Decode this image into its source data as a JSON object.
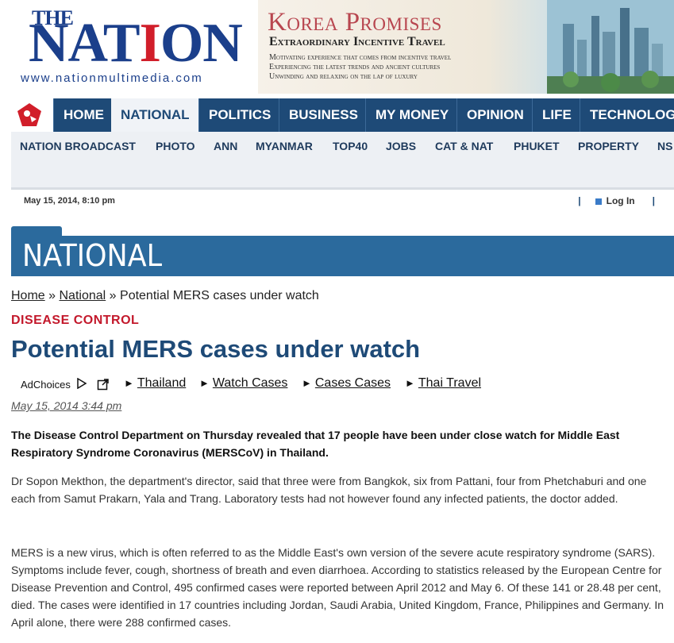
{
  "header": {
    "logo_the": "THE",
    "logo_nation_a": "NAT",
    "logo_nation_i": "I",
    "logo_nation_b": "ON",
    "logo_url": "www.nationmultimedia.com"
  },
  "ad_banner": {
    "headline": "Korea Promises",
    "subheadline": "Extraordinary Incentive Travel",
    "lines": [
      "Motivating experience that comes from incentive travel",
      "Experiencing the latest trends and ancient cultures",
      "Unwinding and relaxing on the lap of luxury"
    ]
  },
  "nav": {
    "main": [
      "HOME",
      "NATIONAL",
      "POLITICS",
      "BUSINESS",
      "MY MONEY",
      "OPINION",
      "LIFE",
      "TECHNOLOG"
    ],
    "active": "NATIONAL",
    "sub": [
      "NATION BROADCAST",
      "PHOTO",
      "ANN",
      "MYANMAR",
      "TOP40",
      "JOBS",
      "CAT & NAT",
      "PHUKET",
      "PROPERTY",
      "NS"
    ]
  },
  "date_bar": {
    "date": "May 15, 2014, 8:10 pm",
    "login": "Log In"
  },
  "section": {
    "title": "NATIONAL"
  },
  "breadcrumb": {
    "home": "Home",
    "sep": "»",
    "national": "National",
    "current": "Potential MERS cases under watch"
  },
  "article": {
    "category": "DISEASE CONTROL",
    "title": "Potential MERS cases under watch",
    "date": "May 15, 2014 3:44 pm",
    "lead": "The Disease Control Department on Thursday revealed that 17 people have been under close watch for Middle East Respiratory Syndrome Coronavirus (MERSCoV) in Thailand.",
    "paragraphs": [
      "Dr Sopon Mekthon, the department's director, said that three were from Bangkok, six from Pattani, four from Phetchaburi and one each from Samut Prakarn, Yala and Trang. Laboratory tests had not however found any infected patients, the doctor added.",
      "MERS is a new virus, which is often referred to as the Middle East's own version of the severe acute respiratory syndrome (SARS). Symptoms include fever, cough, shortness of breath and even diarrhoea. According to statistics released by the European Centre for Disease Prevention and Control, 495 confirmed cases were reported between April 2012 and May 6. Of these 141 or 28.48 per cent, died. The cases were identified in 17 countries including Jordan, Saudi Arabia, United Kingdom, France, Philippines and Germany. In April alone, there were 288 confirmed cases."
    ]
  },
  "ad_links": {
    "adchoices": "AdChoices",
    "arrow": "►",
    "links": [
      "Thailand",
      "Watch Cases",
      "Cases Cases",
      "Thai Travel"
    ]
  },
  "colors": {
    "nav_bg": "#1e4a77",
    "section_bg": "#2b6a9d",
    "category": "#c3182b",
    "title": "#1e4a77"
  }
}
